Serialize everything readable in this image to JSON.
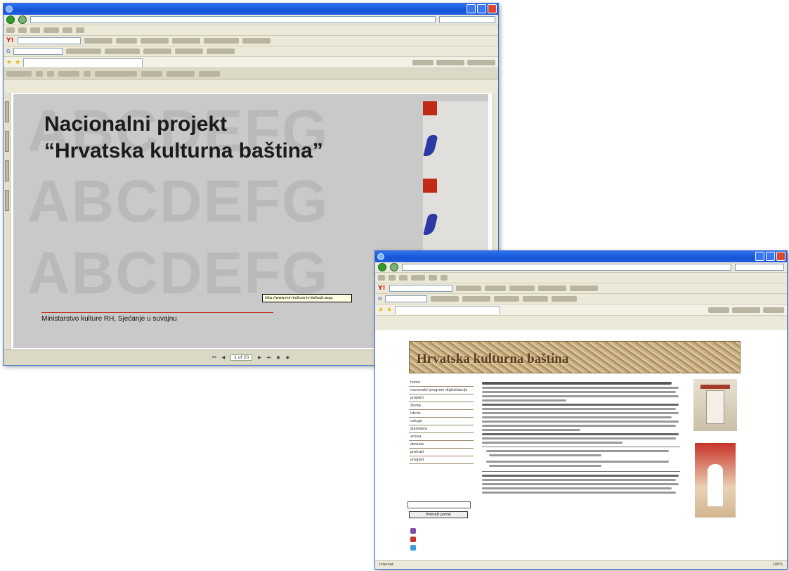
{
  "pdf_window": {
    "slide": {
      "title_line1": "Nacionalni projekt",
      "title_line2": "“Hrvatska kulturna baština”",
      "watermark": "ABCDEFG",
      "footer": "Ministarstvo kulture RH, Sjećanje u suvajnu",
      "tooltip": "http://www.min-kulture.hr/default.aspx"
    },
    "page_indicator": "1 of 20"
  },
  "web_window": {
    "banner_text": "Hrvatska kulturna baština",
    "sidebar_items": [
      "home",
      "nacionalni program digitalizacije",
      "projekti",
      "zbirke",
      "izbrisi",
      "usluge",
      "alati/data",
      "arhiva",
      "obrazac",
      "pretraži",
      "pregled"
    ],
    "search_button": "Pretraži portal",
    "status": {
      "left": "Internet",
      "right": "100%"
    }
  }
}
